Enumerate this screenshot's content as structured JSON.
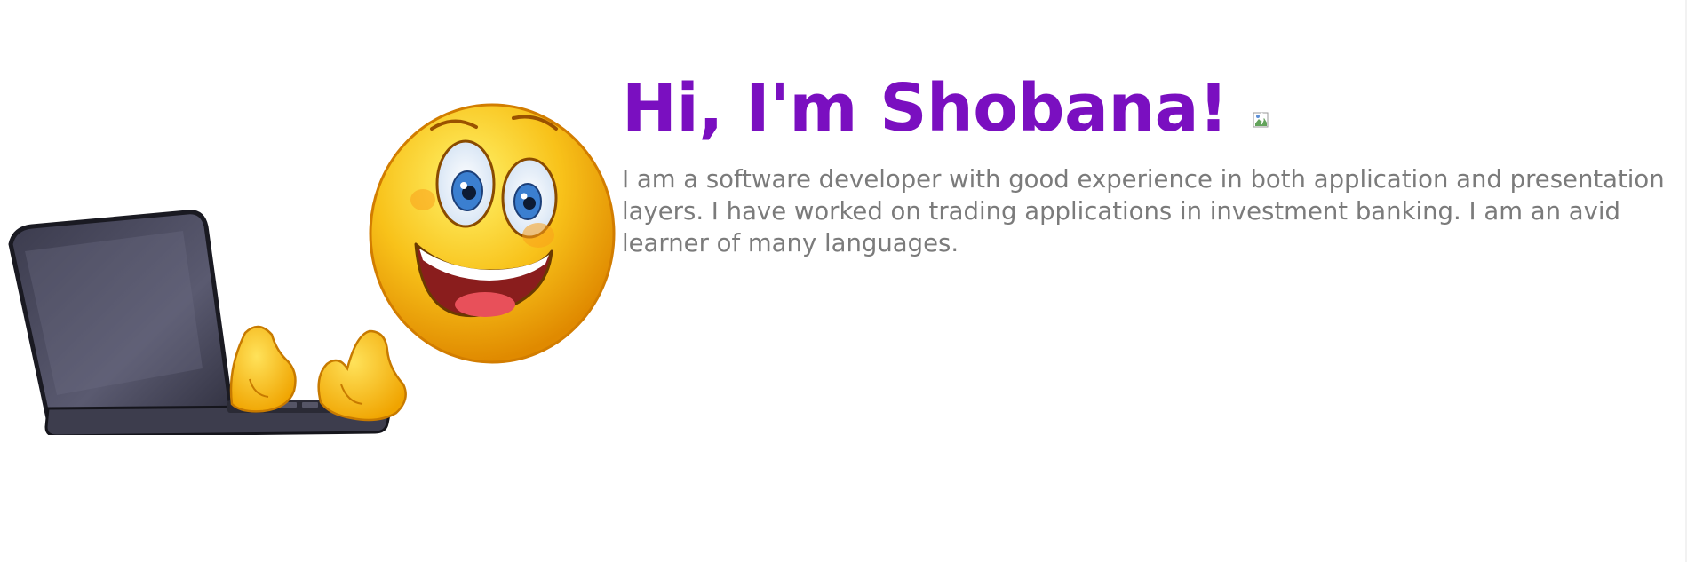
{
  "profile": {
    "title": "Hi, I'm Shobana!",
    "bio": "I am a software developer with good experience in both application and presentation layers. I have worked on trading applications in investment banking. I am an avid learner of many languages."
  },
  "illustration": {
    "icon": "smiley-with-laptop-icon",
    "face_color": "#f8c21a",
    "laptop_color": "#4b4b5e"
  },
  "colors": {
    "title": "#7a0fc0",
    "body_text": "#7b7b7b",
    "background": "#ffffff"
  }
}
